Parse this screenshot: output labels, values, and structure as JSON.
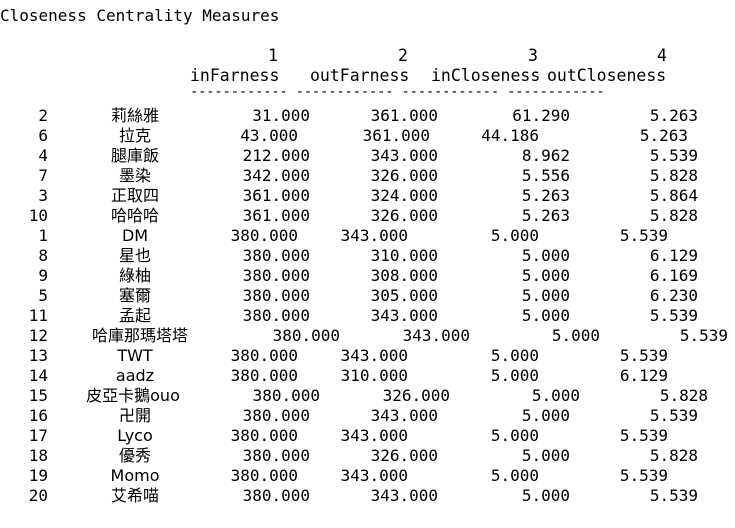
{
  "title": "Closeness Centrality Measures",
  "header": {
    "col_numbers": [
      "1",
      "2",
      "3",
      "4"
    ],
    "col_names": [
      "inFarness",
      "outFarness",
      "inCloseness",
      "outCloseness"
    ],
    "separator": "------------ ------------ ------------ ------------"
  },
  "rows": [
    {
      "id": "2",
      "name": "莉絲雅",
      "in_far": "31.000",
      "out_far": "361.000",
      "in_clo": "61.290",
      "out_clo": "5.263"
    },
    {
      "id": "6",
      "name": "拉克",
      "in_far": "43.000",
      "out_far": "361.000",
      "in_clo": "44.186",
      "out_clo": "5.263"
    },
    {
      "id": "4",
      "name": "腿庫飯",
      "in_far": "212.000",
      "out_far": "343.000",
      "in_clo": "8.962",
      "out_clo": "5.539"
    },
    {
      "id": "7",
      "name": "墨染",
      "in_far": "342.000",
      "out_far": "326.000",
      "in_clo": "5.556",
      "out_clo": "5.828"
    },
    {
      "id": "3",
      "name": "正取四",
      "in_far": "361.000",
      "out_far": "324.000",
      "in_clo": "5.263",
      "out_clo": "5.864"
    },
    {
      "id": "10",
      "name": "哈哈哈",
      "in_far": "361.000",
      "out_far": "326.000",
      "in_clo": "5.263",
      "out_clo": "5.828"
    },
    {
      "id": "1",
      "name": "DM",
      "in_far": "380.000",
      "out_far": "343.000",
      "in_clo": "5.000",
      "out_clo": "5.539"
    },
    {
      "id": "8",
      "name": "星也",
      "in_far": "380.000",
      "out_far": "310.000",
      "in_clo": "5.000",
      "out_clo": "6.129"
    },
    {
      "id": "9",
      "name": "綠柚",
      "in_far": "380.000",
      "out_far": "308.000",
      "in_clo": "5.000",
      "out_clo": "6.169"
    },
    {
      "id": "5",
      "name": "塞爾",
      "in_far": "380.000",
      "out_far": "305.000",
      "in_clo": "5.000",
      "out_clo": "6.230"
    },
    {
      "id": "11",
      "name": "孟起",
      "in_far": "380.000",
      "out_far": "343.000",
      "in_clo": "5.000",
      "out_clo": "5.539"
    },
    {
      "id": "12",
      "name": "哈庫那瑪塔塔",
      "in_far": "380.000",
      "out_far": "343.000",
      "in_clo": "5.000",
      "out_clo": "5.539"
    },
    {
      "id": "13",
      "name": "TWT",
      "in_far": "380.000",
      "out_far": "343.000",
      "in_clo": "5.000",
      "out_clo": "5.539"
    },
    {
      "id": "14",
      "name": "aadz",
      "in_far": "380.000",
      "out_far": "310.000",
      "in_clo": "5.000",
      "out_clo": "6.129"
    },
    {
      "id": "15",
      "name": "皮亞卡鵝ouo",
      "in_far": "380.000",
      "out_far": "326.000",
      "in_clo": "5.000",
      "out_clo": "5.828"
    },
    {
      "id": "16",
      "name": "卍開",
      "in_far": "380.000",
      "out_far": "343.000",
      "in_clo": "5.000",
      "out_clo": "5.539"
    },
    {
      "id": "17",
      "name": "Lyco",
      "in_far": "380.000",
      "out_far": "343.000",
      "in_clo": "5.000",
      "out_clo": "5.539"
    },
    {
      "id": "18",
      "name": "優秀",
      "in_far": "380.000",
      "out_far": "326.000",
      "in_clo": "5.000",
      "out_clo": "5.828"
    },
    {
      "id": "19",
      "name": "Momo",
      "in_far": "380.000",
      "out_far": "343.000",
      "in_clo": "5.000",
      "out_clo": "5.539"
    },
    {
      "id": "20",
      "name": "艾希喵",
      "in_far": "380.000",
      "out_far": "343.000",
      "in_clo": "5.000",
      "out_clo": "5.539"
    }
  ]
}
